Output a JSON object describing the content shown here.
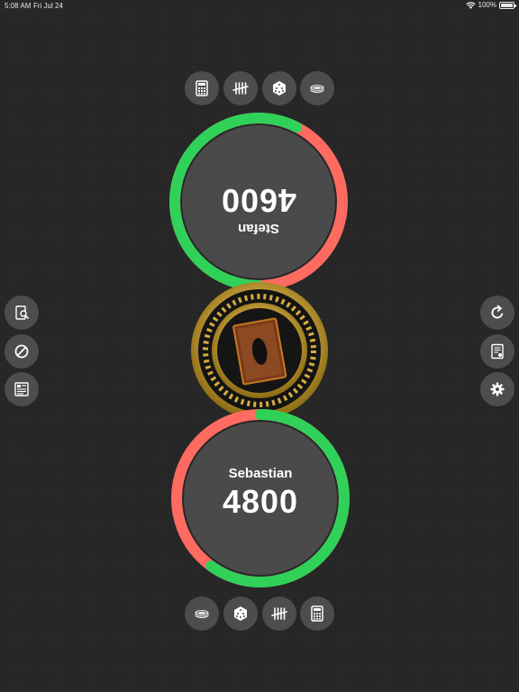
{
  "status_bar": {
    "time": "5:08 AM",
    "date": "Fri Jul 24",
    "battery": "100%"
  },
  "colors": {
    "life_green": "#30d158",
    "life_red": "#ff6b61",
    "panel": "#4a4a4a",
    "button": "#4d4d4d"
  },
  "players": {
    "top": {
      "name": "Stefan",
      "life": "4600",
      "life_fraction": 0.575
    },
    "bottom": {
      "name": "Sebastian",
      "life": "4800",
      "life_fraction": 0.6
    }
  },
  "top_toolbar": [
    "calculator-icon",
    "tally-icon",
    "dice-icon",
    "coin-icon"
  ],
  "bottom_toolbar": [
    "coin-icon",
    "dice-icon",
    "tally-icon",
    "calculator-icon"
  ],
  "left_toolbar": [
    "card-search-icon",
    "prohibit-icon",
    "card-info-icon"
  ],
  "right_toolbar": [
    "reset-icon",
    "log-icon",
    "settings-icon"
  ]
}
